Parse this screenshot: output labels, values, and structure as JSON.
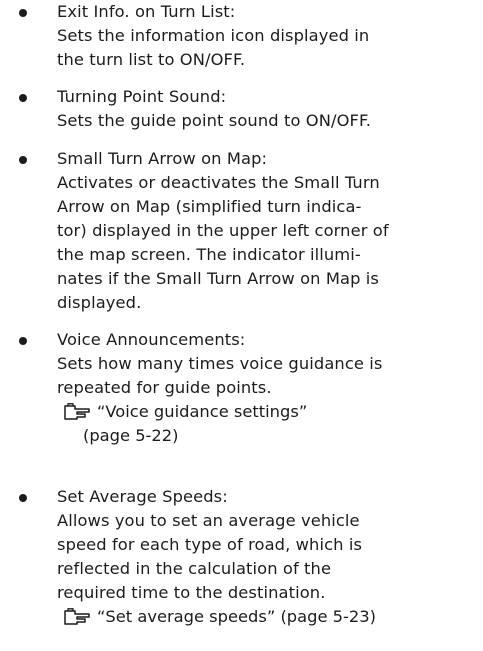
{
  "items": [
    {
      "title": "Exit Info. on Turn List:",
      "desc": [
        "Sets the information icon displayed in",
        "the turn list to ON/OFF."
      ]
    },
    {
      "title": "Turning Point Sound:",
      "desc": [
        "Sets the guide point sound to ON/OFF."
      ]
    },
    {
      "title": "Small Turn Arrow on Map:",
      "desc": [
        "Activates or deactivates the Small Turn",
        "Arrow on Map (simplified turn indica-",
        "tor) displayed in the upper left corner of",
        "the map screen. The indicator illumi-",
        "nates if the Small Turn Arrow on Map is",
        "displayed."
      ]
    },
    {
      "title": "Voice Announcements:",
      "desc": [
        "Sets how many times voice guidance is",
        "repeated for guide points."
      ],
      "ref": {
        "icon": "reference-hand-icon",
        "text": "“Voice guidance settings”",
        "page": "(page 5-22)"
      }
    },
    {
      "title": "Set Average Speeds:",
      "desc": [
        "Allows you to set an average vehicle",
        "speed for each type of road, which is",
        "reflected in the calculation of the",
        "required time to the destination."
      ],
      "ref": {
        "icon": "reference-hand-icon",
        "text": "“Set average speeds” (page 5-23)"
      }
    }
  ]
}
